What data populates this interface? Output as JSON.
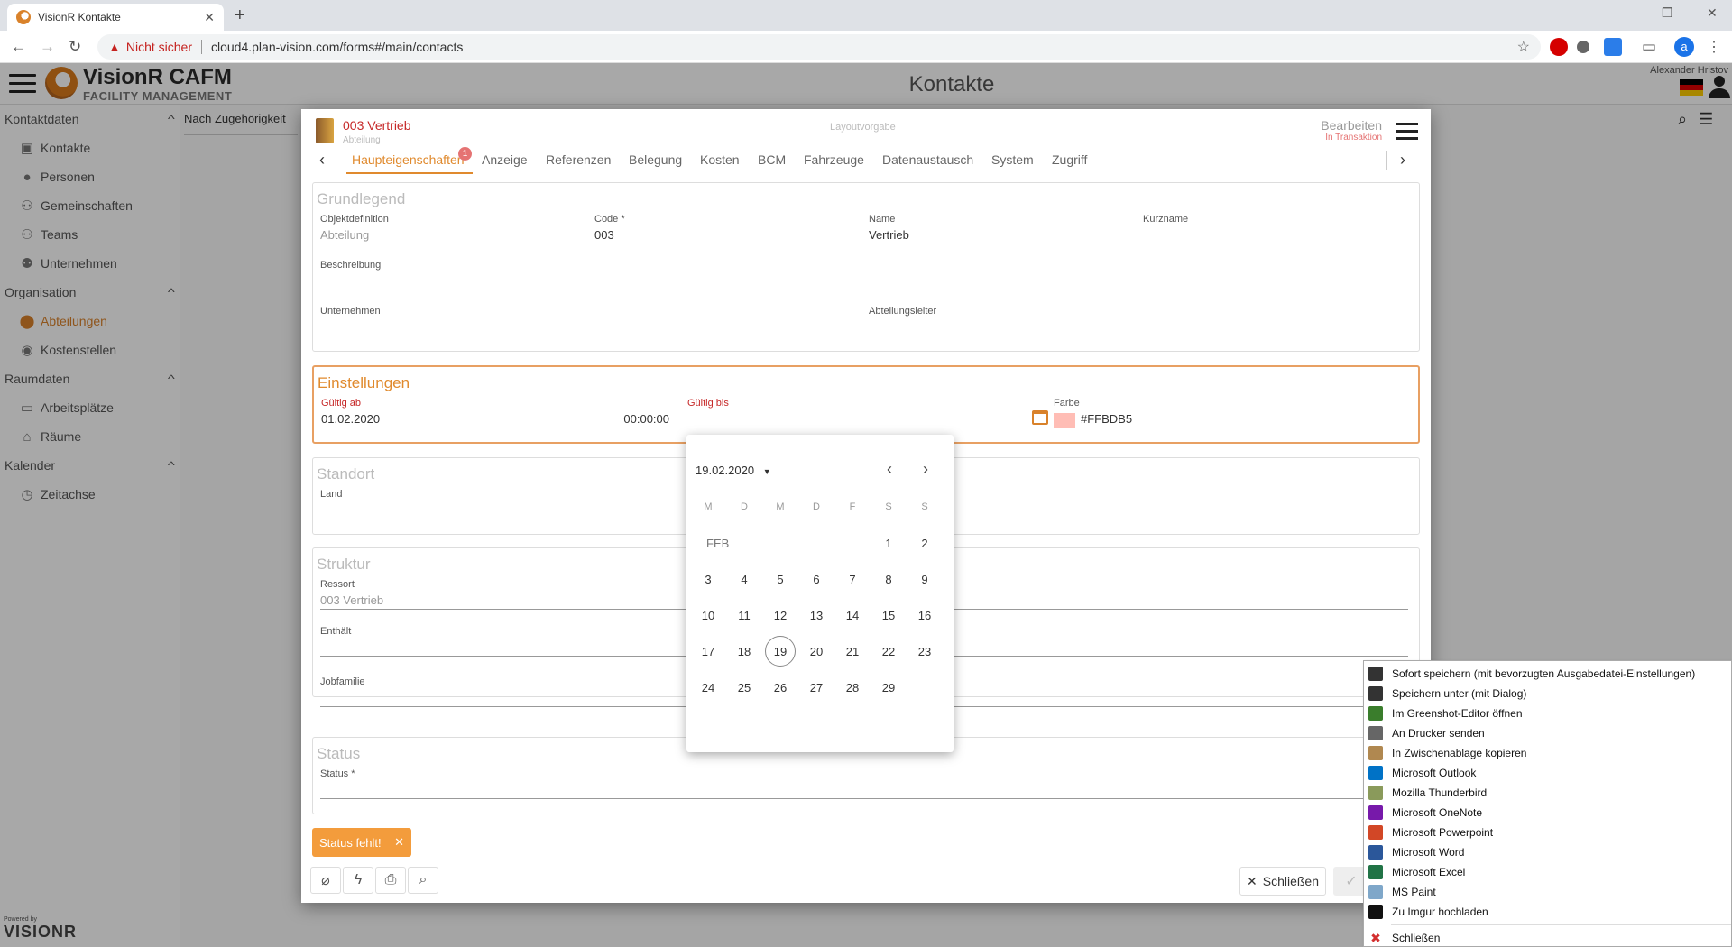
{
  "browser": {
    "tab_title": "VisionR Kontakte",
    "new_tab": "+",
    "insecure_label": "Nicht sicher",
    "url": "cloud4.plan-vision.com/forms#/main/contacts",
    "profile_letter": "a"
  },
  "app": {
    "logo_title": "VisionR CAFM",
    "logo_subtitle": "FACILITY MANAGEMENT",
    "page_title": "Kontakte",
    "user_name": "Alexander Hristov",
    "mid_column_label": "Nach Zugehörigkeit",
    "powered_by": "Powered by",
    "powered_brand": "VISIONR"
  },
  "sidebar": {
    "sections": [
      {
        "label": "Kontaktdaten",
        "items": [
          {
            "label": "Kontakte",
            "icon": "contact-card-icon"
          },
          {
            "label": "Personen",
            "icon": "person-icon"
          },
          {
            "label": "Gemeinschaften",
            "icon": "group-icon"
          },
          {
            "label": "Teams",
            "icon": "team-icon"
          },
          {
            "label": "Unternehmen",
            "icon": "company-icon"
          }
        ]
      },
      {
        "label": "Organisation",
        "items": [
          {
            "label": "Abteilungen",
            "icon": "department-icon",
            "active": true
          },
          {
            "label": "Kostenstellen",
            "icon": "cost-center-icon"
          }
        ]
      },
      {
        "label": "Raumdaten",
        "items": [
          {
            "label": "Arbeitsplätze",
            "icon": "workplace-icon"
          },
          {
            "label": "Räume",
            "icon": "home-icon"
          }
        ]
      },
      {
        "label": "Kalender",
        "items": [
          {
            "label": "Zeitachse",
            "icon": "clock-icon"
          }
        ]
      }
    ]
  },
  "dialog": {
    "object_title": "003 Vertrieb",
    "object_subtitle": "Abteilung",
    "layout_label": "Layoutvorgabe",
    "mode": "Bearbeiten",
    "mode_sub": "In Transaktion",
    "tabs": [
      "Haupteigenschaften",
      "Anzeige",
      "Referenzen",
      "Belegung",
      "Kosten",
      "BCM",
      "Fahrzeuge",
      "Datenaustausch",
      "System",
      "Zugriff"
    ],
    "tab_badge": "1",
    "grundlegend": {
      "title": "Grundlegend",
      "objektdefinition_label": "Objektdefinition",
      "objektdefinition_value": "Abteilung",
      "code_label": "Code *",
      "code_value": "003",
      "name_label": "Name",
      "name_value": "Vertrieb",
      "kurzname_label": "Kurzname",
      "beschreibung_label": "Beschreibung",
      "unternehmen_label": "Unternehmen",
      "abteilungsleiter_label": "Abteilungsleiter"
    },
    "einstellungen": {
      "title": "Einstellungen",
      "gueltig_ab_label": "Gültig ab",
      "gueltig_ab_date": "01.02.2020",
      "gueltig_ab_time": "00:00:00",
      "gueltig_bis_label": "Gültig bis",
      "farbe_label": "Farbe",
      "farbe_value": "#FFBDB5"
    },
    "standort": {
      "title": "Standort",
      "land_label": "Land"
    },
    "struktur": {
      "title": "Struktur",
      "ressort_label": "Ressort",
      "ressort_value": "003 Vertrieb",
      "enthaelt_label": "Enthält",
      "jobfamilie_label": "Jobfamilie"
    },
    "status": {
      "title": "Status",
      "status_label": "Status *"
    },
    "status_chip": "Status fehlt!",
    "close_label": "Schließen"
  },
  "calendar": {
    "selected_label": "19.02.2020",
    "weekdays": [
      "M",
      "D",
      "M",
      "D",
      "F",
      "S",
      "S"
    ],
    "month_label": "FEB",
    "today": 19,
    "weeks": [
      [
        "",
        "",
        "",
        "",
        "",
        "1",
        "2"
      ],
      [
        "3",
        "4",
        "5",
        "6",
        "7",
        "8",
        "9"
      ],
      [
        "10",
        "11",
        "12",
        "13",
        "14",
        "15",
        "16"
      ],
      [
        "17",
        "18",
        "19",
        "20",
        "21",
        "22",
        "23"
      ],
      [
        "24",
        "25",
        "26",
        "27",
        "28",
        "29",
        ""
      ]
    ]
  },
  "context_menu": {
    "items": [
      {
        "label": "Sofort speichern (mit bevorzugten Ausgabedatei-Einstellungen)",
        "icon": "floppy-icon",
        "color": "#333333"
      },
      {
        "label": "Speichern unter (mit Dialog)",
        "icon": "floppy-icon",
        "color": "#333333"
      },
      {
        "label": "Im Greenshot-Editor öffnen",
        "icon": "greenshot-icon",
        "color": "#3a7d2c"
      },
      {
        "label": "An Drucker senden",
        "icon": "printer-icon",
        "color": "#666666"
      },
      {
        "label": "In Zwischenablage kopieren",
        "icon": "clipboard-icon",
        "color": "#b08850"
      },
      {
        "label": "Microsoft Outlook",
        "icon": "outlook-icon",
        "color": "#0072c6"
      },
      {
        "label": "Mozilla Thunderbird",
        "icon": "thunderbird-icon",
        "color": "#8a9a5b"
      },
      {
        "label": "Microsoft OneNote",
        "icon": "onenote-icon",
        "color": "#7719aa"
      },
      {
        "label": "Microsoft Powerpoint",
        "icon": "powerpoint-icon",
        "color": "#d24726"
      },
      {
        "label": "Microsoft Word",
        "icon": "word-icon",
        "color": "#2b579a"
      },
      {
        "label": "Microsoft Excel",
        "icon": "excel-icon",
        "color": "#217346"
      },
      {
        "label": "MS Paint",
        "icon": "paint-icon",
        "color": "#7fa7c9"
      },
      {
        "label": "Zu Imgur hochladen",
        "icon": "imgur-icon",
        "color": "#111111"
      }
    ],
    "close_label": "Schließen",
    "close_color": "#d32f2f"
  }
}
